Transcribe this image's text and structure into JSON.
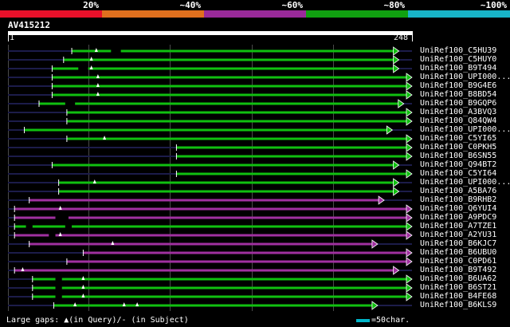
{
  "scale": {
    "segments": [
      {
        "label": "20%",
        "color": "#e8102a"
      },
      {
        "label": "~40%",
        "color": "#e0701e"
      },
      {
        "label": "~60%",
        "color": "#9a2a9a"
      },
      {
        "label": "~80%",
        "color": "#10a010"
      },
      {
        "label": "~100%",
        "color": "#18b4c8"
      }
    ]
  },
  "query": {
    "name": "AV415212",
    "start": "1",
    "end": "248",
    "length": 248
  },
  "hits": [
    {
      "label": "UniRef100_C5HU39",
      "color": "#10c010",
      "start": 40,
      "end": 240,
      "gaps": [
        {
          "s": 64,
          "e": 70,
          "type": "subject"
        }
      ],
      "markers": [
        55
      ]
    },
    {
      "label": "UniRef100_C5HUY0",
      "color": "#10c010",
      "start": 35,
      "end": 240,
      "gaps": [],
      "markers": [
        52
      ]
    },
    {
      "label": "UniRef100_B9T494",
      "color": "#10c010",
      "start": 28,
      "end": 240,
      "gaps": [
        {
          "s": 44,
          "e": 50,
          "type": "subject"
        }
      ],
      "markers": [
        52
      ]
    },
    {
      "label": "UniRef100_UPI000...",
      "color": "#10c010",
      "start": 28,
      "end": 248,
      "gaps": [],
      "markers": [
        56
      ]
    },
    {
      "label": "UniRef100_B9G4E6",
      "color": "#10c010",
      "start": 28,
      "end": 248,
      "gaps": [],
      "markers": [
        56
      ]
    },
    {
      "label": "UniRef100_B8BD54",
      "color": "#10c010",
      "start": 28,
      "end": 248,
      "gaps": [],
      "markers": [
        56
      ]
    },
    {
      "label": "UniRef100_B9GQP6",
      "color": "#10c010",
      "start": 20,
      "end": 243,
      "gaps": [
        {
          "s": 36,
          "e": 42,
          "type": "subject"
        }
      ],
      "markers": []
    },
    {
      "label": "UniRef100_A3BVQ3",
      "color": "#10c010",
      "start": 37,
      "end": 248,
      "gaps": [],
      "markers": []
    },
    {
      "label": "UniRef100_Q84QW4",
      "color": "#10c010",
      "start": 37,
      "end": 248,
      "gaps": [],
      "markers": []
    },
    {
      "label": "UniRef100_UPI000...",
      "color": "#10c010",
      "start": 11,
      "end": 236,
      "gaps": [],
      "markers": []
    },
    {
      "label": "UniRef100_C5YI65",
      "color": "#10c010",
      "start": 37,
      "end": 248,
      "gaps": [],
      "markers": [
        60
      ]
    },
    {
      "label": "UniRef100_C0PKH5",
      "color": "#10c010",
      "start": 104,
      "end": 248,
      "gaps": [],
      "markers": []
    },
    {
      "label": "UniRef100_B6SN55",
      "color": "#10c010",
      "start": 104,
      "end": 248,
      "gaps": [],
      "markers": []
    },
    {
      "label": "UniRef100_Q94BT2",
      "color": "#10c010",
      "start": 28,
      "end": 240,
      "gaps": [],
      "markers": []
    },
    {
      "label": "UniRef100_C5YI64",
      "color": "#10c010",
      "start": 104,
      "end": 248,
      "gaps": [],
      "markers": []
    },
    {
      "label": "UniRef100_UPI000...",
      "color": "#10c010",
      "start": 32,
      "end": 240,
      "gaps": [],
      "markers": [
        54
      ]
    },
    {
      "label": "UniRef100_A5BA76",
      "color": "#10c010",
      "start": 32,
      "end": 240,
      "gaps": [],
      "markers": []
    },
    {
      "label": "UniRef100_B9RHB2",
      "color": "#a030a0",
      "start": 14,
      "end": 231,
      "gaps": [],
      "markers": []
    },
    {
      "label": "UniRef100_Q6YUI4",
      "color": "#a030a0",
      "start": 5,
      "end": 248,
      "gaps": [],
      "markers": [
        33
      ]
    },
    {
      "label": "UniRef100_A9PDC9",
      "color": "#a030a0",
      "start": 5,
      "end": 248,
      "gaps": [
        {
          "s": 30,
          "e": 38,
          "type": "subject"
        }
      ],
      "markers": []
    },
    {
      "label": "UniRef100_A7TZE1",
      "color": "#10c010",
      "start": 5,
      "end": 248,
      "gaps": [
        {
          "s": 12,
          "e": 16,
          "type": "subject"
        },
        {
          "s": 36,
          "e": 40,
          "type": "subject"
        }
      ],
      "markers": []
    },
    {
      "label": "UniRef100_A2YU31",
      "color": "#a030a0",
      "start": 5,
      "end": 248,
      "gaps": [
        {
          "s": 26,
          "e": 30,
          "type": "subject"
        }
      ],
      "markers": [
        33
      ]
    },
    {
      "label": "UniRef100_B6KJC7",
      "color": "#a030a0",
      "start": 14,
      "end": 227,
      "gaps": [],
      "markers": [
        65
      ]
    },
    {
      "label": "UniRef100_B6UBU0",
      "color": "#a030a0",
      "start": 47,
      "end": 248,
      "gaps": [],
      "markers": []
    },
    {
      "label": "UniRef100_C0PD61",
      "color": "#a030a0",
      "start": 37,
      "end": 248,
      "gaps": [],
      "markers": []
    },
    {
      "label": "UniRef100_B9T492",
      "color": "#a030a0",
      "start": 5,
      "end": 240,
      "gaps": [],
      "markers": [
        10
      ]
    },
    {
      "label": "UniRef100_B6UA62",
      "color": "#10c010",
      "start": 16,
      "end": 248,
      "gaps": [
        {
          "s": 30,
          "e": 34,
          "type": "subject"
        }
      ],
      "markers": [
        47
      ]
    },
    {
      "label": "UniRef100_B6ST21",
      "color": "#10c010",
      "start": 16,
      "end": 248,
      "gaps": [
        {
          "s": 30,
          "e": 34,
          "type": "subject"
        }
      ],
      "markers": [
        47
      ]
    },
    {
      "label": "UniRef100_B4FE68",
      "color": "#10c010",
      "start": 16,
      "end": 248,
      "gaps": [
        {
          "s": 30,
          "e": 34,
          "type": "subject"
        }
      ],
      "markers": [
        47
      ]
    },
    {
      "label": "UniRef100_B6KLS9",
      "color": "#10c010",
      "start": 29,
      "end": 227,
      "gaps": [],
      "markers": [
        42,
        72,
        80
      ]
    }
  ],
  "footer": {
    "gaps_text": "Large gaps: ▲(in Query)/- (in Subject)",
    "legend_text": "=50char."
  }
}
